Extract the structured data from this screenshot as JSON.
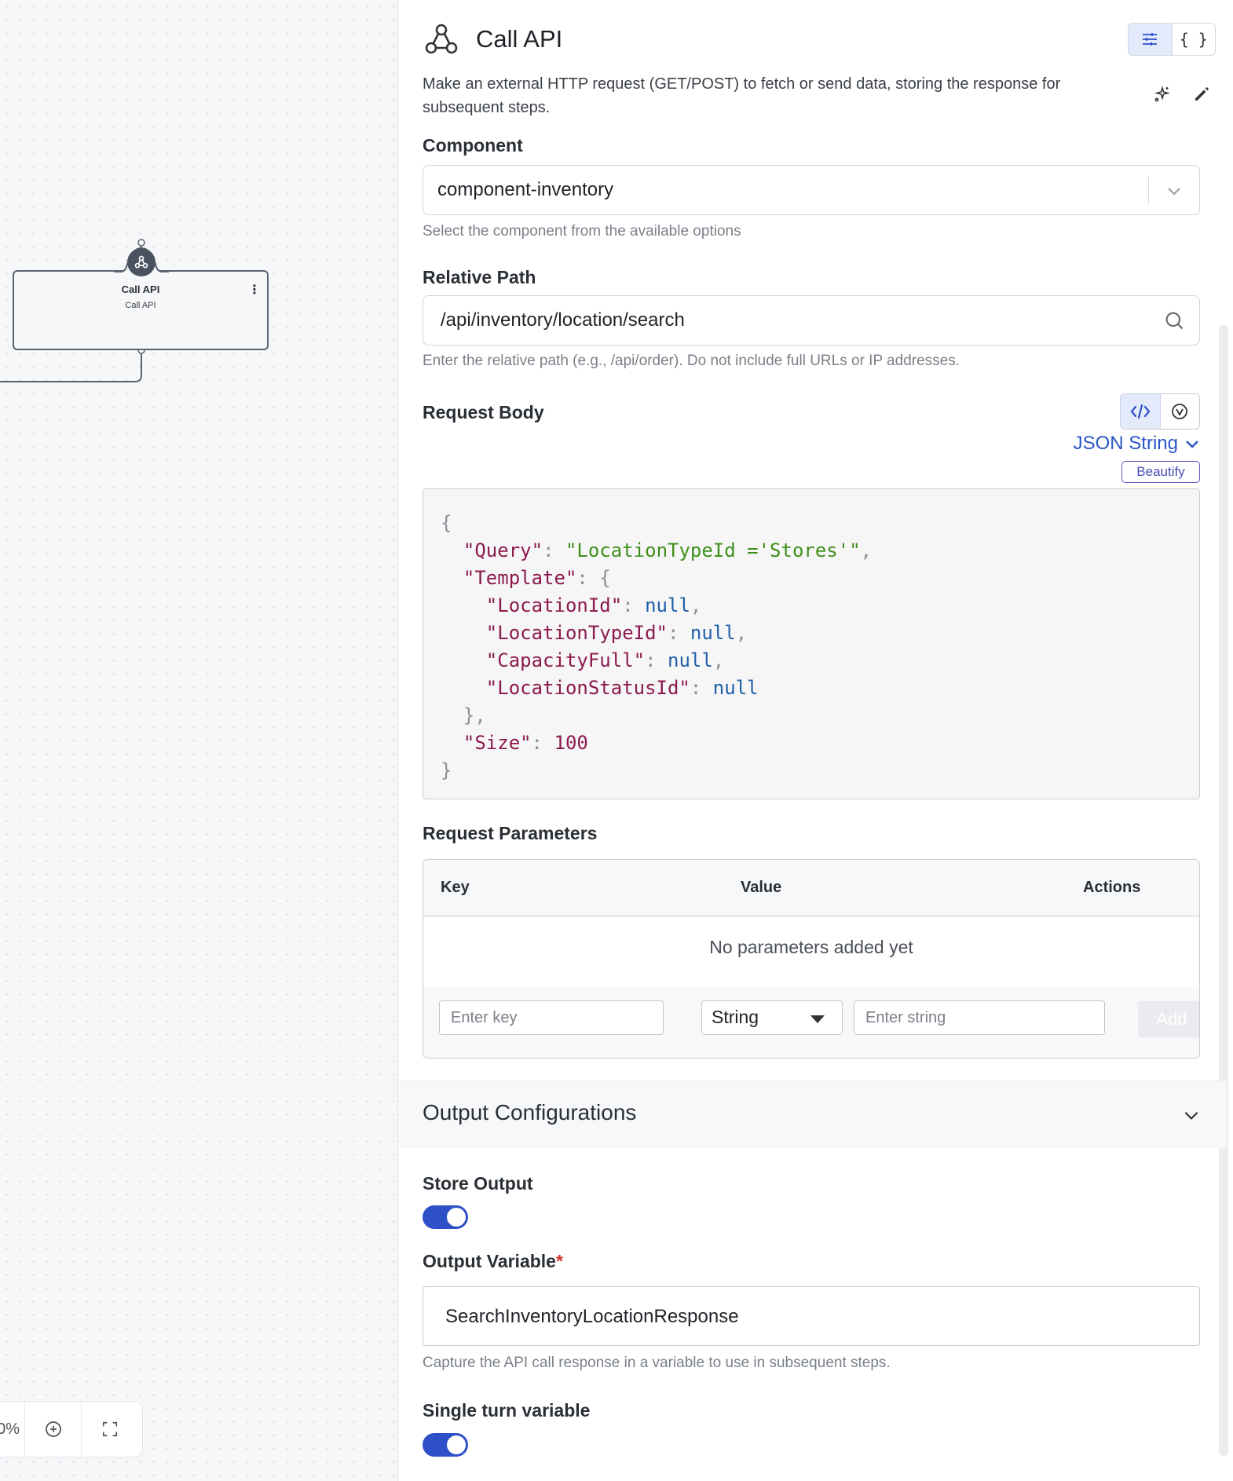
{
  "canvas": {
    "node": {
      "title": "Call API",
      "subtitle": "Call API",
      "menu": "⋮"
    },
    "zoom": {
      "percent": "0%"
    }
  },
  "panel": {
    "title": "Call API",
    "description": "Make an external HTTP request (GET/POST) to fetch or send data, storing the response for subsequent steps.",
    "view_toggle": {
      "form_icon": "sliders-icon",
      "json_label": "{ }"
    },
    "component": {
      "label": "Component",
      "value": "component-inventory",
      "helper": "Select the component from the available options"
    },
    "relative_path": {
      "label": "Relative Path",
      "value": "/api/inventory/location/search",
      "helper": "Enter the relative path (e.g., /api/order). Do not include full URLs or IP addresses."
    },
    "request_body": {
      "label": "Request Body",
      "type": "JSON String",
      "beautify": "Beautify",
      "code": {
        "open": "{",
        "query_key": "\"Query\"",
        "query_val": "\"LocationTypeId ='Stores'\"",
        "template_key": "\"Template\"",
        "location_id_key": "\"LocationId\"",
        "location_type_id_key": "\"LocationTypeId\"",
        "capacity_full_key": "\"CapacityFull\"",
        "location_status_id_key": "\"LocationStatusId\"",
        "null": "null",
        "size_key": "\"Size\"",
        "size_val": "100",
        "close": "}"
      }
    },
    "request_parameters": {
      "label": "Request Parameters",
      "columns": [
        "Key",
        "Value",
        "Actions"
      ],
      "empty": "No parameters added yet",
      "key_placeholder": "Enter key",
      "type_value": "String",
      "value_placeholder": "Enter string",
      "add_label": "Add"
    },
    "output_config": {
      "title": "Output Configurations",
      "store_output_label": "Store Output",
      "store_output_on": true,
      "output_variable_label": "Output Variable",
      "required_mark": "*",
      "output_variable_value": "SearchInventoryLocationResponse",
      "output_variable_helper": "Capture the API call response in a variable to use in subsequent steps.",
      "single_turn_label": "Single turn variable",
      "single_turn_on": true
    }
  },
  "colors": {
    "accent": "#2d4fc7",
    "link": "#2c55c4",
    "beautify": "#5a5bc0"
  }
}
